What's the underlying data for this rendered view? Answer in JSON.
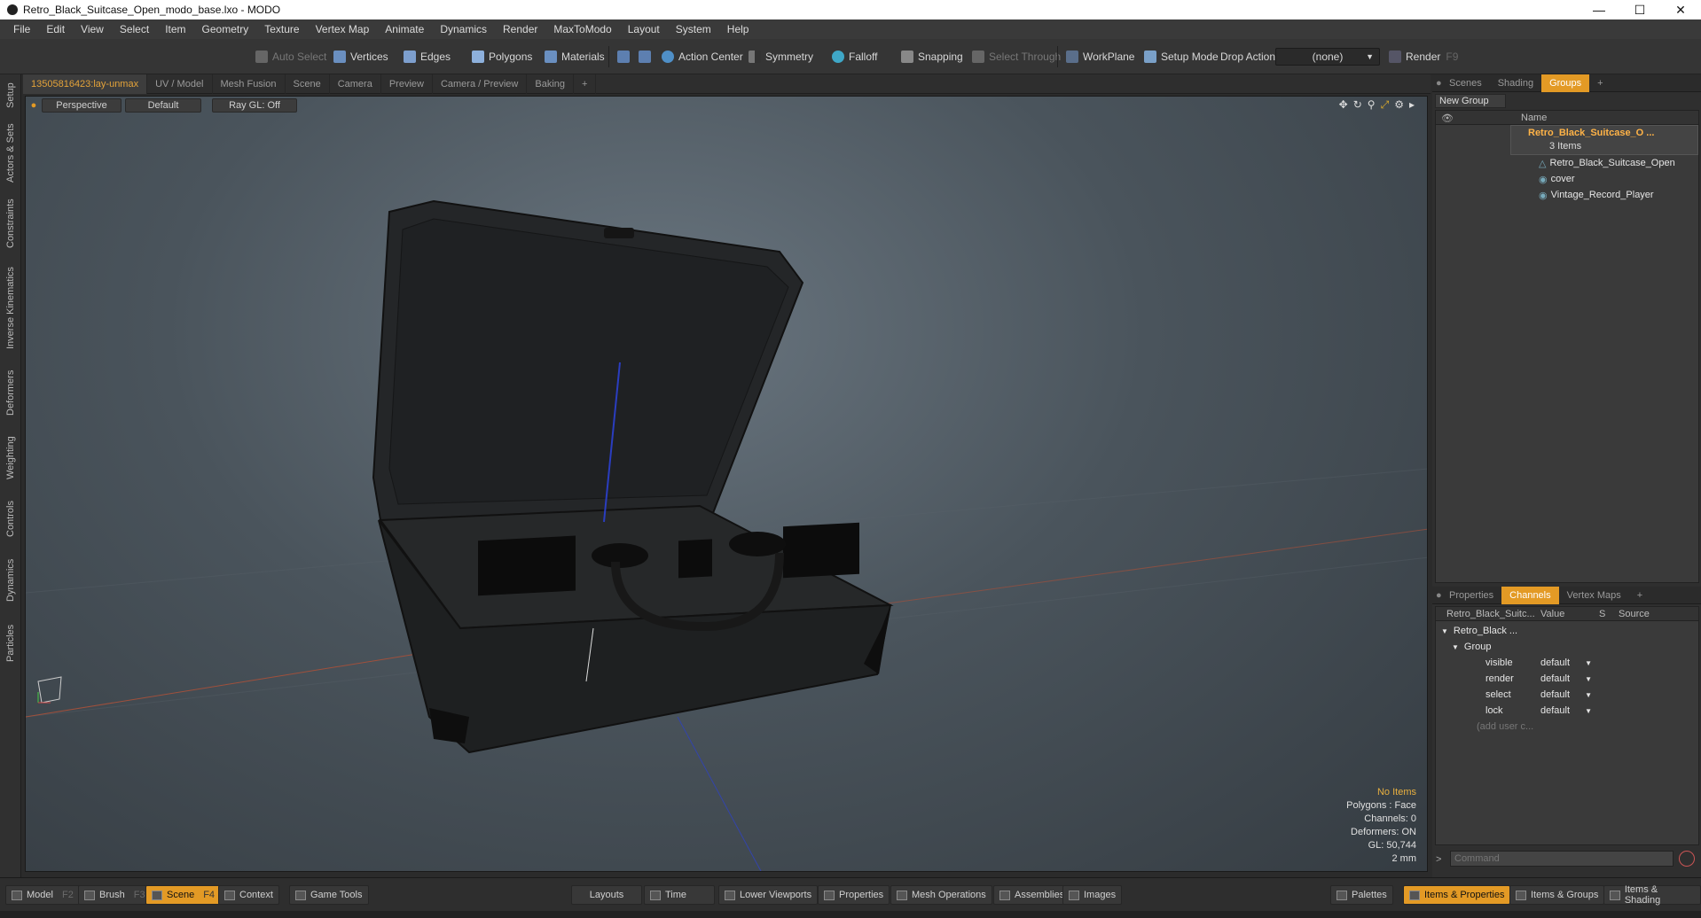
{
  "window": {
    "title": "Retro_Black_Suitcase_Open_modo_base.lxo - MODO"
  },
  "menu": [
    "File",
    "Edit",
    "View",
    "Select",
    "Item",
    "Geometry",
    "Texture",
    "Vertex Map",
    "Animate",
    "Dynamics",
    "Render",
    "MaxToModo",
    "Layout",
    "System",
    "Help"
  ],
  "toolbar": {
    "auto_select": "Auto Select",
    "vertices": "Vertices",
    "edges": "Edges",
    "polygons": "Polygons",
    "materials": "Materials",
    "action_center": "Action Center",
    "symmetry": "Symmetry",
    "falloff": "Falloff",
    "snapping": "Snapping",
    "select_through": "Select Through",
    "workplane": "WorkPlane",
    "setup_mode": "Setup Mode",
    "drop_action": "Drop Action",
    "drop_action_value": "(none)",
    "render": "Render",
    "render_key": "F9"
  },
  "left_tabs": [
    "Setup",
    "Actors & Sets",
    "Constraints",
    "Inverse Kinematics",
    "Deformers",
    "Weighting",
    "Controls",
    "Dynamics",
    "Particles"
  ],
  "viewport_tabs": [
    "13505816423:lay-unmax",
    "UV / Model",
    "Mesh Fusion",
    "Scene",
    "Camera",
    "Preview",
    "Camera / Preview",
    "Baking",
    "+"
  ],
  "viewport": {
    "view": "Perspective",
    "shading": "Default",
    "raygl": "Ray GL: Off",
    "info": {
      "no_items": "No Items",
      "polygons": "Polygons : Face",
      "channels": "Channels: 0",
      "deformers": "Deformers: ON",
      "gl": "GL: 50,744",
      "unit": "2 mm"
    }
  },
  "groups_panel": {
    "tabs": [
      "Scenes",
      "Shading",
      "Groups",
      "+"
    ],
    "new_group": "New Group",
    "name_header": "Name",
    "group_name": "Retro_Black_Suitcase_O ...",
    "group_count": "3 Items",
    "items": [
      "Retro_Black_Suitcase_Open",
      "cover",
      "Vintage_Record_Player"
    ]
  },
  "channels_panel": {
    "tabs": [
      "Properties",
      "Channels",
      "Vertex Maps",
      "+"
    ],
    "headers": [
      "Retro_Black_Suitc...",
      "Value",
      "S",
      "Source"
    ],
    "root": "Retro_Black ...",
    "group": "Group",
    "rows": [
      {
        "name": "visible",
        "value": "default"
      },
      {
        "name": "render",
        "value": "default"
      },
      {
        "name": "select",
        "value": "default"
      },
      {
        "name": "lock",
        "value": "default"
      }
    ],
    "add_user": "(add user c...",
    "command_placeholder": "Command"
  },
  "bottom": {
    "model": "Model",
    "model_key": "F2",
    "brush": "Brush",
    "brush_key": "F3",
    "scene": "Scene",
    "scene_key": "F4",
    "context": "Context",
    "game_tools": "Game Tools",
    "layouts": "Layouts",
    "time": "Time",
    "lower_viewports": "Lower Viewports",
    "properties": "Properties",
    "mesh_operations": "Mesh Operations",
    "assemblies": "Assemblies",
    "images": "Images",
    "palettes": "Palettes",
    "items_properties": "Items & Properties",
    "items_groups": "Items & Groups",
    "items_shading": "Items & Shading"
  },
  "colors": {
    "accent": "#e39a25",
    "panel": "#2f2f2f",
    "viewport": "#4a545c"
  }
}
